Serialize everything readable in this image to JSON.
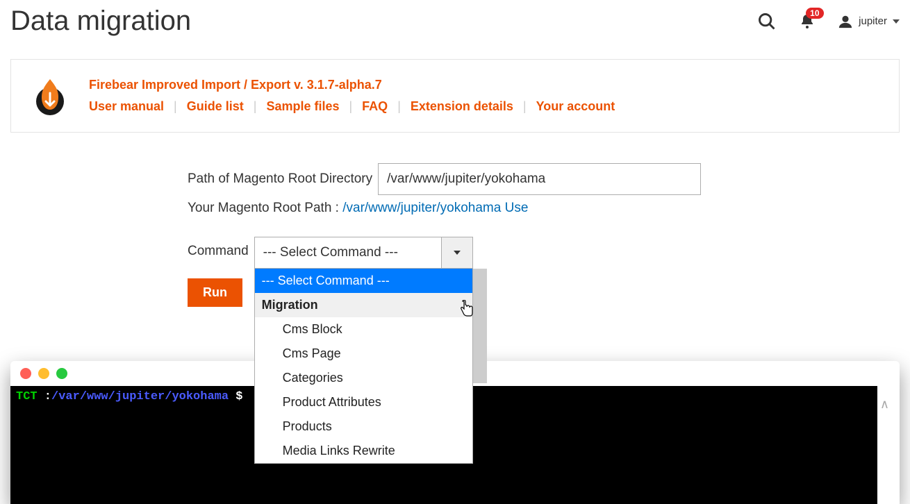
{
  "header": {
    "title": "Data migration",
    "notification_count": "10",
    "username": "jupiter"
  },
  "infobox": {
    "title": "Firebear Improved Import / Export v. 3.1.7-alpha.7",
    "links": [
      "User manual",
      "Guide list",
      "Sample files",
      "FAQ",
      "Extension details",
      "Your account"
    ]
  },
  "form": {
    "path_label": "Path of Magento Root Directory",
    "path_value": "/var/www/jupiter/yokohama",
    "root_path_prefix": "Your Magento Root Path : ",
    "root_path_link": "/var/www/jupiter/yokohama Use",
    "command_label": "Command",
    "command_selected": "--- Select Command ---",
    "run_label": "Run",
    "dropdown": {
      "placeholder": "--- Select Command ---",
      "group": "Migration",
      "items": [
        "Cms Block",
        "Cms Page",
        "Categories",
        "Product Attributes",
        "Products",
        "Media Links Rewrite"
      ]
    }
  },
  "terminal": {
    "prompt_label": "TCT",
    "sep": " :",
    "path": "/var/www/jupiter/yokohama",
    "dollar": " $"
  }
}
